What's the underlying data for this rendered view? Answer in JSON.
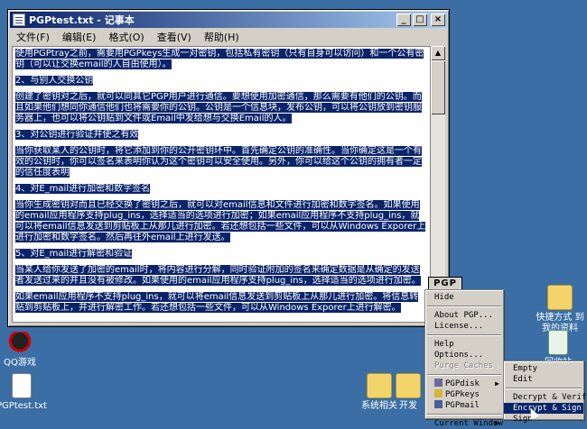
{
  "window": {
    "title": "PGPtest.txt - 记事本",
    "menu": [
      "文件(F)",
      "编辑(E)",
      "格式(O)",
      "查看(V)",
      "帮助(H)"
    ],
    "minimize": "_",
    "maximize": "□",
    "close": "×"
  },
  "document": {
    "paragraphs": [
      "使用PGPtray之前，需要用PGPkeys生成一对密钥，包括私有密钥（只有自身可以访问）和一个公有密钥（可以让交换email的人自由使用）。",
      "2、与别人交换公钥",
      "创建了密钥对之后，就可以同其它PGP用户进行通信。要想使用加密通信，那么需要有他们的公钥。而且如果他们想同你通信他们也将需要你的公钥。公钥是一个信息块，发布公钥，可以将公钥放到密钥服务器上，也可以将公钥贴到文件或Email中发给想与交换Email的人。",
      "3、对公钥进行验证并使之有效",
      "当你获取某人的公钥时，将它添加到你的公开密钥环中。首先确定公钥的准确性。当你确定这是一个有效的公钥时，你可以签名来表明你认为这个密钥可以安全使用。另外，你可以给这个公钥的拥有者一定的信任度表明",
      "4、对E_mail进行加密和数字签名",
      "当你生成密钥对而且已经交换了密钥之后，就可以对email信息和文件进行加密和数字签名。如果使用的email应用程序支持plug_ins，选择适当的选项进行加密；如果email应用程序不支持plug_ins，就可以将email信息发送到剪贴板上从那儿进行加密。若还想包括一些文件，可以从Windows Exporer上进行加密和数字签名。然后再往外email上进行发送。",
      "5、对E_mail进行解密和验证",
      "当某人给你发送了加密的email时，将内容进行分解，同时验证附加的签名来确定数据是从确定的发送者发送过来的并且没有被修改。如果使用的email应用程序支持plug_ins，选择适当的选项进行加密。",
      "如果email应用程序不支持plug_ins，就可以将email信息发送到剪贴板上从那儿进行加密。将信息转贴到剪贴板上，并进行解密工作。若还想包括一些文件，可以从Windows Exporer上进行解密。"
    ]
  },
  "desktop": {
    "icons": [
      {
        "label": "QQ游戏"
      },
      {
        "label": "PGPtest.txt"
      },
      {
        "label": "系统相关"
      },
      {
        "label": "开发"
      },
      {
        "label": "快捷方式 到 我的资料"
      },
      {
        "label": "回收站"
      }
    ]
  },
  "pgp_tray": {
    "tag": "PGP",
    "main_menu": [
      "Hide",
      "About PGP...",
      "License...",
      "Help",
      "Options...",
      "Purge Caches",
      "PGPdisk",
      "PGPkeys",
      "PGPmail",
      "Current Window"
    ],
    "sub_menu": [
      "Empty",
      "Edit",
      "Decrypt & Verify",
      "Encrypt & Sign",
      "Sign"
    ]
  },
  "colors": {
    "desktop": "#3a6ea5",
    "selection": "#0a246a",
    "menu_bg": "#d4d0c8"
  }
}
